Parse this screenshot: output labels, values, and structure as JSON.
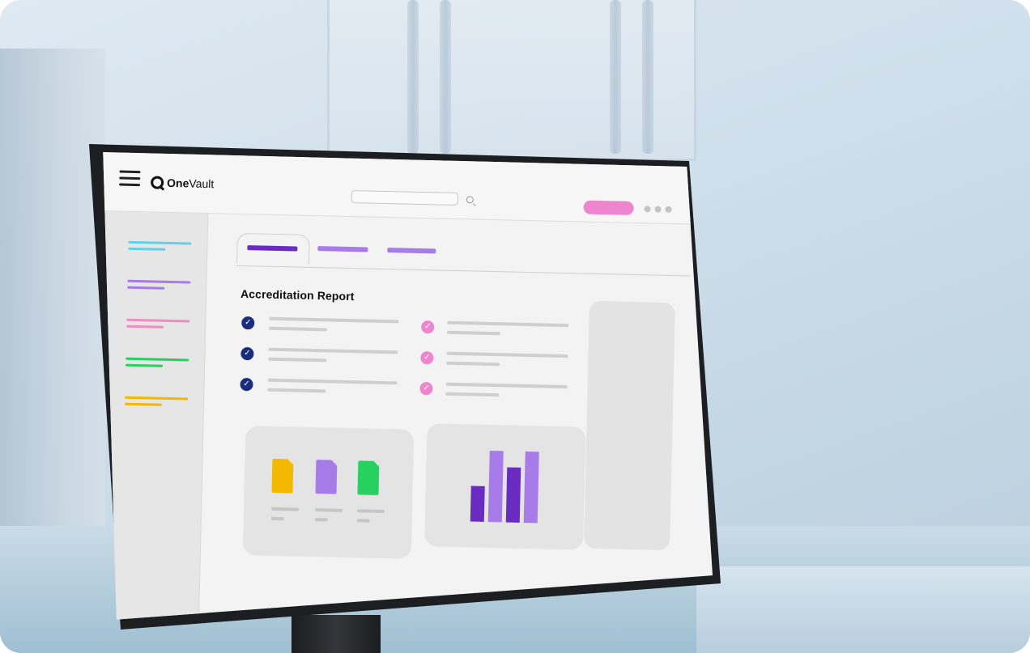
{
  "app": {
    "brand_bold": "One",
    "brand_light": "Vault",
    "icons": {
      "menu": "hamburger-menu-icon",
      "logo": "onevault-logo-icon",
      "search": "search-icon",
      "more": "more-dots-icon",
      "check": "check-circle-icon"
    },
    "check_glyph": "✓"
  },
  "colors": {
    "navy": "#1a2d7c",
    "pink": "#ee86cf",
    "purple_dark": "#6a2bc0",
    "purple_light": "#a77be8",
    "cyan": "#5fd2ea",
    "rose": "#f08cc4",
    "green": "#27d15f",
    "yellow": "#f3b800"
  },
  "main": {
    "report_title": "Accreditation Report"
  }
}
